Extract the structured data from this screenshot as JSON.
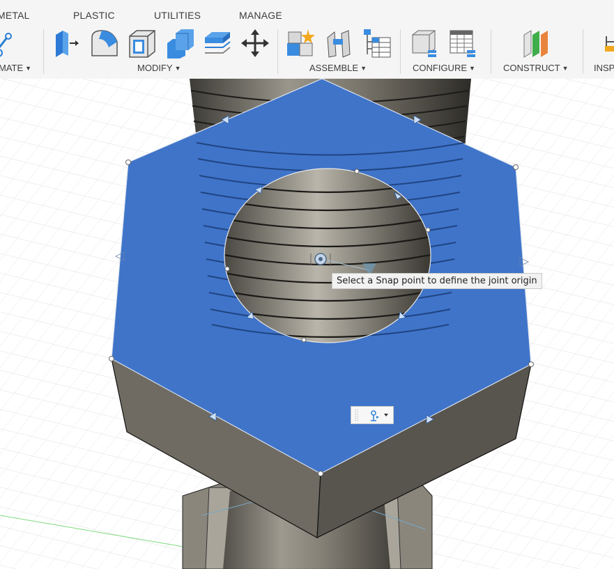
{
  "toolbar": {
    "tabs": [
      "METAL",
      "PLASTIC",
      "UTILITIES",
      "MANAGE"
    ],
    "groups": {
      "create": "MATE",
      "modify": "MODIFY",
      "assemble": "ASSEMBLE",
      "configure": "CONFIGURE",
      "construct": "CONSTRUCT",
      "inspect": "INSP"
    },
    "icons": {
      "modify": [
        "press-pull-icon",
        "fillet-icon",
        "shell-icon",
        "combine-icon",
        "offset-face-icon",
        "move-icon"
      ],
      "assemble": [
        "new-component-icon",
        "joint-icon",
        "component-tree-icon"
      ],
      "configure": [
        "configure-icon",
        "configuration-table-icon"
      ],
      "construct": [
        "offset-plane-icon"
      ],
      "inspect": [
        "measure-icon"
      ]
    }
  },
  "viewport": {
    "tooltip": "Select a Snap point to define the joint origin",
    "mini_toolbar_icon": "joint-origin-icon",
    "selection_color": "#3a6fc4",
    "model_color": "#6e6a60"
  }
}
